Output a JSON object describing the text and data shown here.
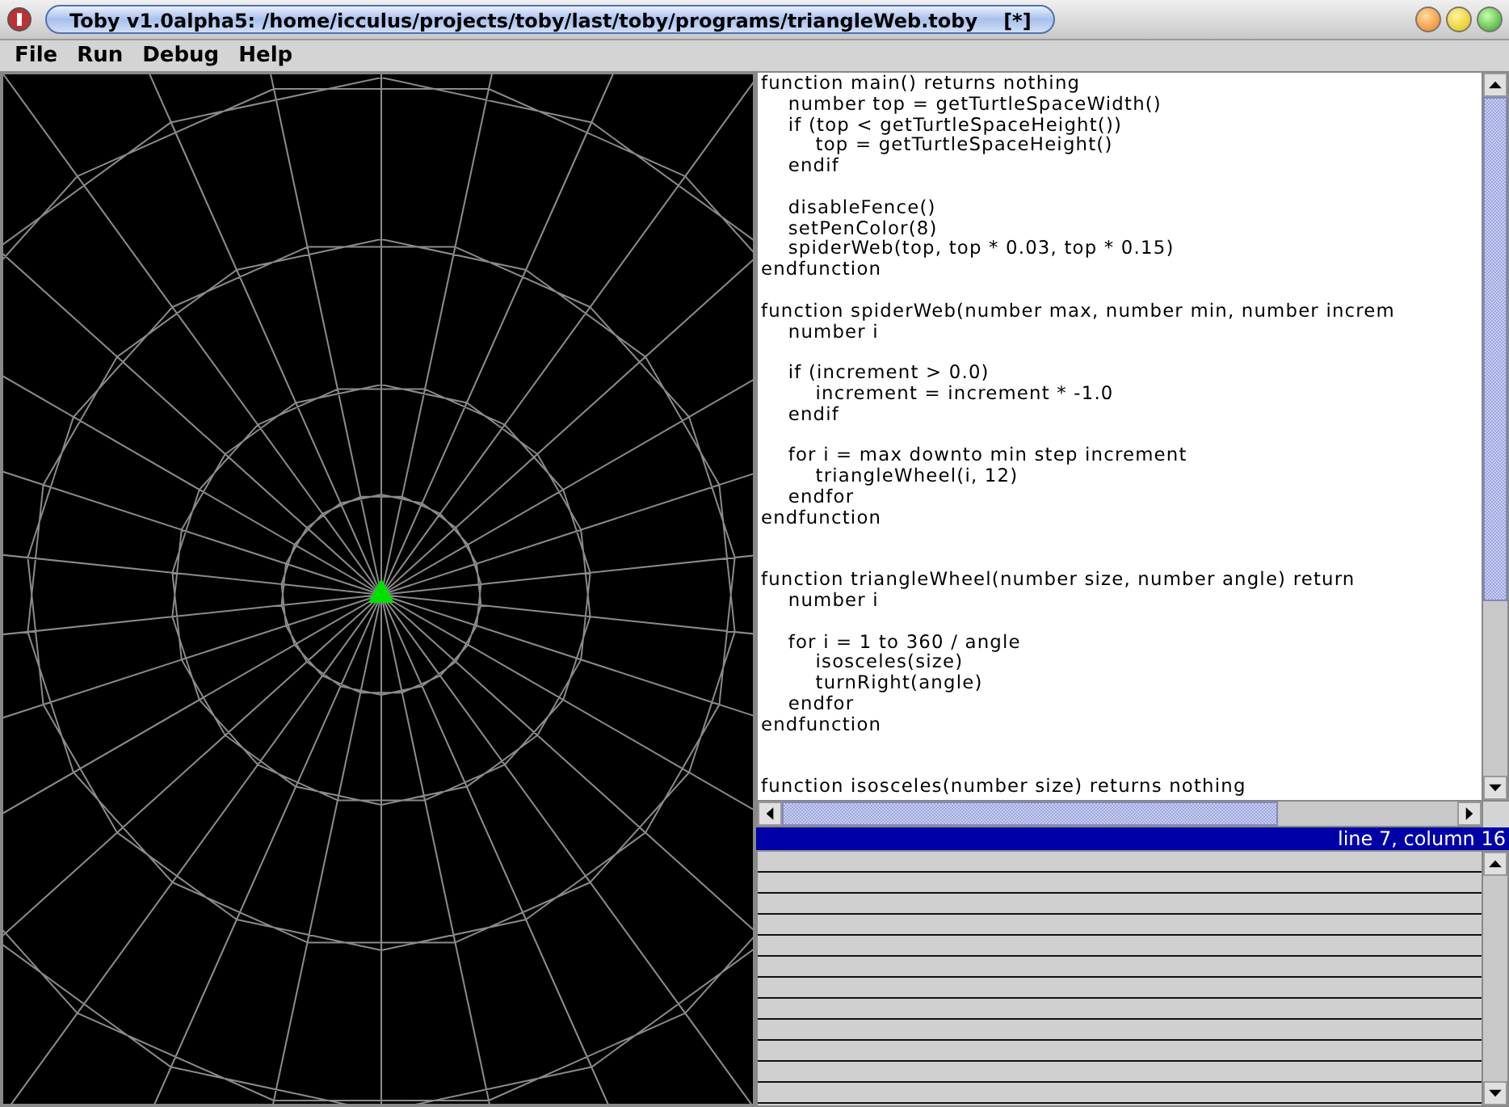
{
  "window": {
    "title": "Toby v1.0alpha5: /home/icculus/projects/toby/last/toby/programs/triangleWeb.toby",
    "modified_mark": "[*]"
  },
  "menu": [
    "File",
    "Run",
    "Debug",
    "Help"
  ],
  "editor": {
    "code": "function main() returns nothing\n    number top = getTurtleSpaceWidth()\n    if (top < getTurtleSpaceHeight())\n        top = getTurtleSpaceHeight()\n    endif\n\n    disableFence()\n    setPenColor(8)\n    spiderWeb(top, top * 0.03, top * 0.15)\nendfunction\n\nfunction spiderWeb(number max, number min, number increm\n    number i\n\n    if (increment > 0.0)\n        increment = increment * -1.0\n    endif\n\n    for i = max downto min step increment\n        triangleWheel(i, 12)\n    endfor\nendfunction\n\n\nfunction triangleWheel(number size, number angle) return\n    number i\n\n    for i = 1 to 360 / angle\n        isosceles(size)\n        turnRight(angle)\n    endfor\nendfunction\n\n\nfunction isosceles(number size) returns nothing"
  },
  "status_bar": "line 7, column 16"
}
